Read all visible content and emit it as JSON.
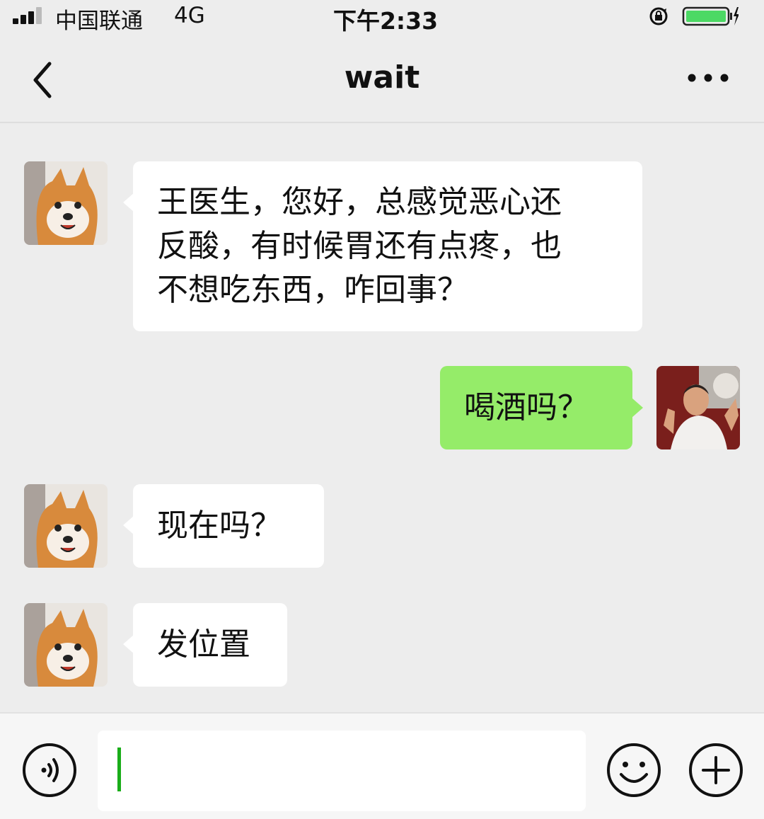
{
  "status_bar": {
    "carrier": "中国联通",
    "network": "4G",
    "time": "下午2:33",
    "signal_icon": "signal-bars-icon",
    "orientation_lock_icon": "orientation-lock-icon",
    "battery_icon": "battery-charging-icon",
    "battery_color": "#4cd964"
  },
  "nav": {
    "title": "wait",
    "back_icon": "chevron-left-icon",
    "more_icon": "more-dots-icon"
  },
  "colors": {
    "background": "#ededed",
    "incoming_bubble": "#ffffff",
    "outgoing_bubble": "#95ec69",
    "caret": "#1aad19"
  },
  "messages": [
    {
      "direction": "incoming",
      "avatar": "shiba-dog-avatar",
      "lines": [
        "王医生，您好，总感觉恶心还",
        "反酸，有时候胃还有点疼，也",
        "不想吃东西，咋回事？"
      ]
    },
    {
      "direction": "outgoing",
      "avatar": "doctor-avatar",
      "lines": [
        "喝酒吗？"
      ]
    },
    {
      "direction": "incoming",
      "avatar": "shiba-dog-avatar",
      "lines": [
        "现在吗？"
      ]
    },
    {
      "direction": "incoming",
      "avatar": "shiba-dog-avatar",
      "lines": [
        "发位置"
      ]
    }
  ],
  "input_bar": {
    "voice_icon": "voice-input-icon",
    "emoji_icon": "emoji-icon",
    "plus_icon": "plus-icon",
    "value": ""
  }
}
